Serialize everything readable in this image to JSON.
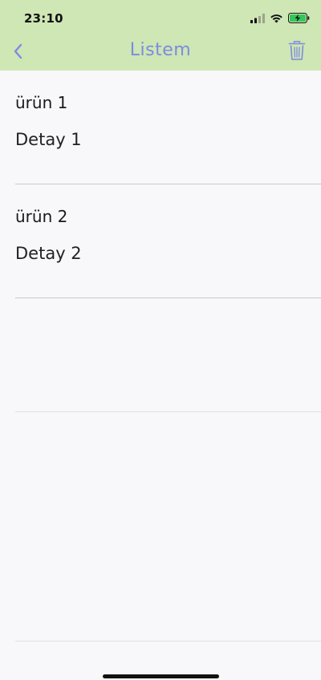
{
  "status_bar": {
    "time": "23:10"
  },
  "nav": {
    "title": "Listem",
    "back_icon": "chevron-left-icon",
    "delete_icon": "trash-icon",
    "accent_color": "#7c8ce0",
    "bar_color": "#cfe6b5"
  },
  "items": [
    {
      "name": "ürün 1",
      "detail": "Detay 1"
    },
    {
      "name": "ürün 2",
      "detail": "Detay 2"
    }
  ]
}
